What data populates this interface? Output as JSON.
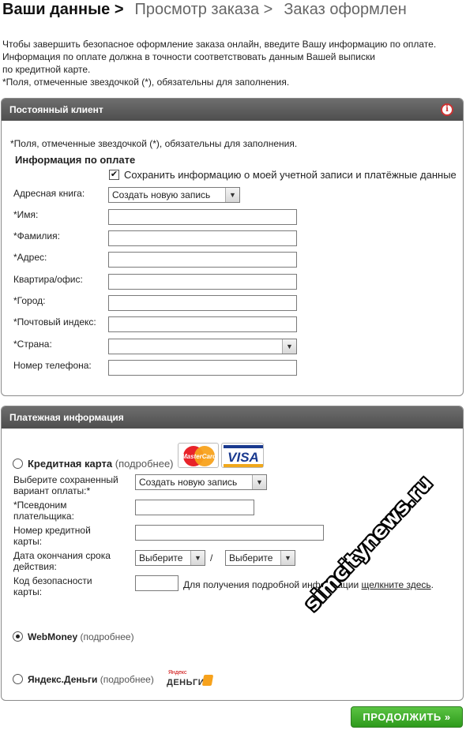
{
  "steps": {
    "current": "Ваши данные >",
    "review": "Просмотр заказа >",
    "done": "Заказ оформлен"
  },
  "intro": {
    "line1": "Чтобы завершить безопасное оформление заказа онлайн, введите Вашу информацию по оплате.",
    "line2": "Информация по оплате должна в точности соответствовать данным Вашей выписки",
    "line3": "по кредитной карте.",
    "line4": "*Поля, отмеченные звездочкой (*), обязательны для заполнения."
  },
  "customer_panel": {
    "title": "Постоянный клиент",
    "info_icon": "i",
    "required_note": "*Поля, отмеченные звездочкой (*), обязательны для заполнения.",
    "billing_heading": "Информация по оплате",
    "save_info_label": "Сохранить информацию о моей учетной записи и платёжные данные",
    "save_info_checked": true,
    "address_book_label": "Адресная книга:",
    "address_book_value": "Создать новую запись",
    "first_name_label": "*Имя:",
    "last_name_label": "*Фамилия:",
    "address_label": "*Адрес:",
    "apartment_label": "Квартира/офис:",
    "city_label": "*Город:",
    "postal_label": "*Почтовый индекс:",
    "country_label": "*Страна:",
    "country_value": "",
    "phone_label": "Номер телефона:"
  },
  "payment_panel": {
    "title": "Платежная информация",
    "credit_card_label": "Кредитная карта",
    "more_label": "(подробнее)",
    "mastercard_text": "MasterCard",
    "visa_text": "VISA",
    "saved_method_label": "Выберите сохраненный вариант оплаты:*",
    "saved_method_value": "Создать новую запись",
    "payer_alias_label": "*Псевдоним плательщика:",
    "card_number_label": "Номер кредитной карты:",
    "expiry_label": "Дата окончания срока действия:",
    "expiry_month_value": "Выберите",
    "expiry_separator": "/",
    "expiry_year_value": "Выберите",
    "cvv_label": "Код безопасности карты:",
    "cvv_help_text": "Для получения подробной информации",
    "cvv_help_link": "щелкните здесь",
    "cvv_help_period": ".",
    "webmoney_label": "WebMoney",
    "webmoney_selected": true,
    "yandex_label": "Яндекс.Деньги",
    "yandex_logo_top": "Яндекс",
    "yandex_logo_bottom": "ДЕНЬГИ"
  },
  "continue_button": "ПРОДОЛЖИТЬ »",
  "watermark": "simcitynews.ru",
  "colors": {
    "panel_header": "#5a5a5a",
    "continue_green": "#3aa825",
    "radio_selected": "#222222"
  }
}
